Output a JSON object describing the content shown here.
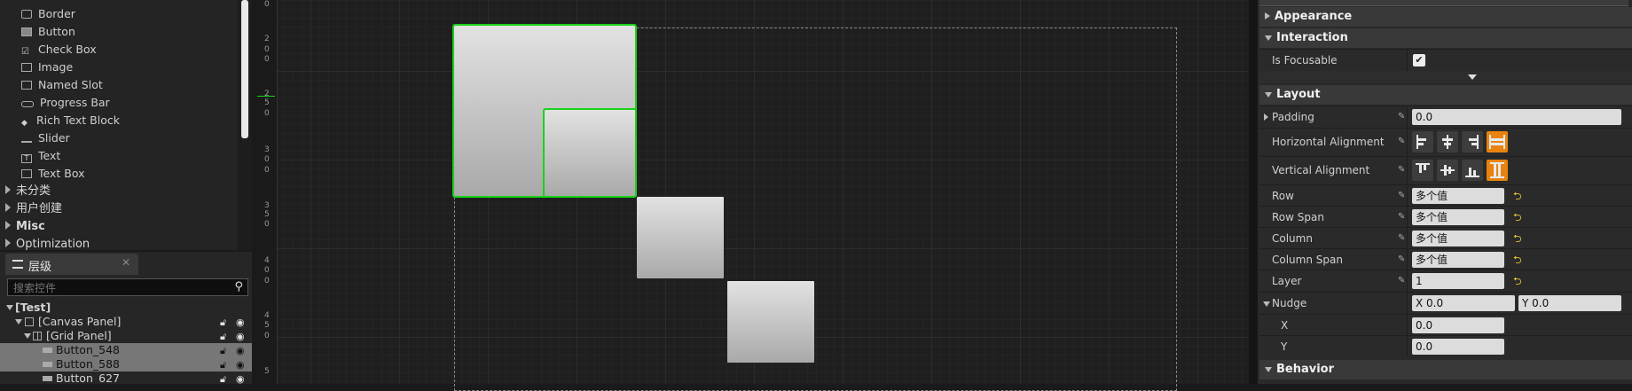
{
  "palette": {
    "items": [
      {
        "label": "Border",
        "icon": "border-icon"
      },
      {
        "label": "Button",
        "icon": "button-icon"
      },
      {
        "label": "Check Box",
        "icon": "checkbox-icon"
      },
      {
        "label": "Image",
        "icon": "image-icon"
      },
      {
        "label": "Named Slot",
        "icon": "named-slot-icon"
      },
      {
        "label": "Progress Bar",
        "icon": "progress-bar-icon"
      },
      {
        "label": "Rich Text Block",
        "icon": "rich-text-icon"
      },
      {
        "label": "Slider",
        "icon": "slider-icon"
      },
      {
        "label": "Text",
        "icon": "text-icon"
      },
      {
        "label": "Text Box",
        "icon": "textbox-icon"
      }
    ],
    "categories": [
      "未分类",
      "用户创建",
      "Misc",
      "Optimization"
    ]
  },
  "hierarchy": {
    "tab_label": "层级",
    "search_placeholder": "搜索控件",
    "rows": [
      "[Test]",
      "[Canvas Panel]",
      "[Grid Panel]",
      "Button_548",
      "Button_588",
      "Button_627"
    ]
  },
  "ruler": {
    "labels": [
      "0",
      "2",
      "0",
      "0",
      "2",
      "5",
      "0",
      "3",
      "0",
      "0",
      "3",
      "5",
      "0",
      "4",
      "0",
      "0",
      "4",
      "5",
      "0",
      "5"
    ]
  },
  "details": {
    "sections": {
      "appearance": "Appearance",
      "interaction": "Interaction",
      "layout": "Layout",
      "behavior": "Behavior"
    },
    "is_focusable_label": "Is Focusable",
    "is_focusable_checked": true,
    "padding_label": "Padding",
    "padding_value": "0.0",
    "halign_label": "Horizontal Alignment",
    "valign_label": "Vertical Alignment",
    "row_label": "Row",
    "row_value": "多个值",
    "rowspan_label": "Row Span",
    "rowspan_value": "多个值",
    "column_label": "Column",
    "column_value": "多个值",
    "colspan_label": "Column Span",
    "colspan_value": "多个值",
    "layer_label": "Layer",
    "layer_value": "1",
    "nudge_label": "Nudge",
    "nudge_x_value": "X  0.0",
    "nudge_y_value": "Y  0.0",
    "x_label": "X",
    "x_value": "0.0",
    "y_label": "Y",
    "y_value": "0.0"
  },
  "colors": {
    "selection": "#19d219",
    "accent": "#e8830f",
    "reset_arrow": "#e5c537"
  }
}
